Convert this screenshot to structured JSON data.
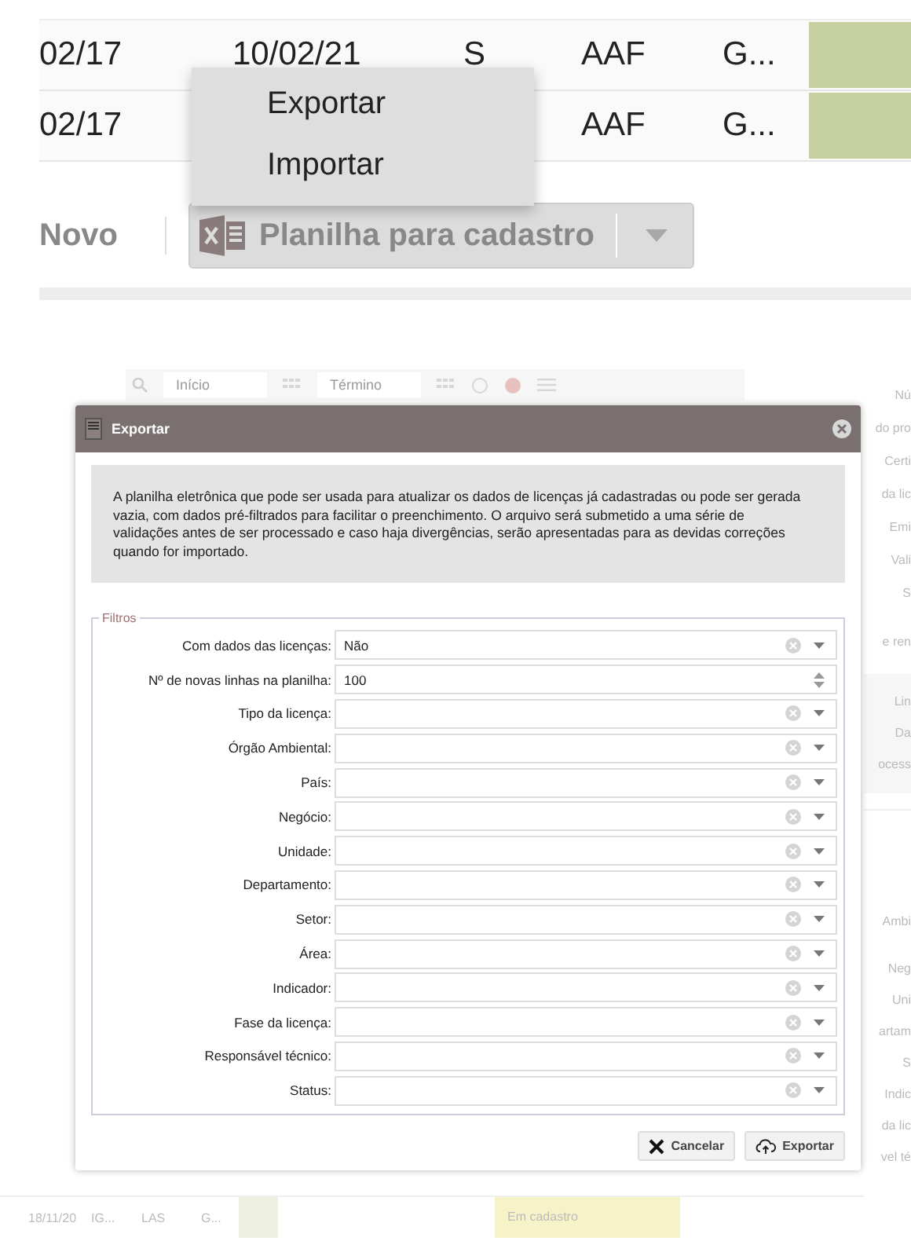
{
  "table": {
    "rows": [
      {
        "cells": [
          "02/17",
          "10/02/21",
          "S",
          "AAF",
          "G..."
        ]
      },
      {
        "cells": [
          "02/17",
          null,
          null,
          "AAF",
          "G..."
        ]
      }
    ]
  },
  "context_menu": {
    "items": [
      {
        "label": "Exportar"
      },
      {
        "label": "Importar"
      }
    ]
  },
  "toolbar": {
    "new_label": "Novo",
    "split_button": {
      "label": "Planilha para cadastro"
    }
  },
  "background_page": {
    "toolbar": {
      "start_placeholder": "Início",
      "end_placeholder": "Término"
    },
    "side_panel": {
      "groups": [
        [
          "Nú",
          "do pro",
          "Certi",
          "da lic",
          "Emi",
          "Vali",
          "S"
        ],
        [
          "e ren"
        ],
        [
          "Lin",
          "Da",
          "ocess"
        ],
        [
          "Ambi"
        ],
        [
          "Neg",
          "Uni",
          "artam",
          "S",
          "Indic",
          "da lic",
          "vel té"
        ]
      ]
    },
    "bottom_row": {
      "cells": [
        "18/11/20",
        "IG...",
        "LAS",
        "G..."
      ],
      "status": "Em cadastro"
    }
  },
  "dialog": {
    "title": "Exportar",
    "description": "A planilha eletrônica que pode ser usada para atualizar os dados de licenças já cadastradas ou pode ser gerada vazia, com dados pré-filtrados para facilitar o preenchimento. O arquivo será submetido a uma série de validações antes de ser processado e caso haja divergências, serão apresentadas para as devidas correções quando for importado.",
    "fieldset_title": "Filtros",
    "fields": [
      {
        "label": "Com dados das licenças:",
        "kind": "select",
        "value": "Não"
      },
      {
        "label": "Nº de novas linhas na planilha:",
        "kind": "number",
        "value": "100"
      },
      {
        "label": "Tipo da licença:",
        "kind": "select"
      },
      {
        "label": "Órgão Ambiental:",
        "kind": "select"
      },
      {
        "label": "País:",
        "kind": "select"
      },
      {
        "label": "Negócio:",
        "kind": "select"
      },
      {
        "label": "Unidade:",
        "kind": "select"
      },
      {
        "label": "Departamento:",
        "kind": "select"
      },
      {
        "label": "Setor:",
        "kind": "select"
      },
      {
        "label": "Área:",
        "kind": "select"
      },
      {
        "label": "Indicador:",
        "kind": "select"
      },
      {
        "label": "Fase da licença:",
        "kind": "select"
      },
      {
        "label": "Responsável técnico:",
        "kind": "select"
      },
      {
        "label": "Status:",
        "kind": "select"
      }
    ],
    "buttons": [
      {
        "kind": "cancel",
        "label": "Cancelar"
      },
      {
        "kind": "export",
        "label": "Exportar"
      }
    ]
  }
}
